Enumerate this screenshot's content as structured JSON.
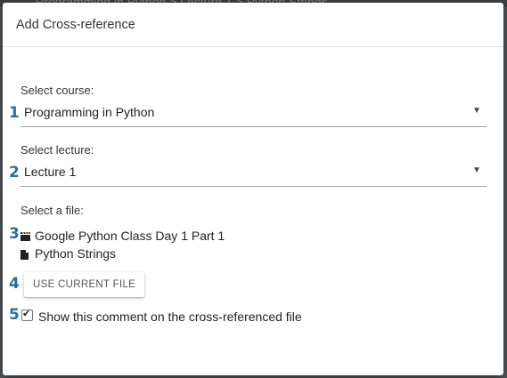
{
  "background": {
    "text": "Programming in Python  >  Lecture 1  >  Python Strings"
  },
  "dialog": {
    "title": "Add Cross-reference",
    "course": {
      "label": "Select course:",
      "value": "Programming in Python",
      "step": "1"
    },
    "lecture": {
      "label": "Select lecture:",
      "value": "Lecture 1",
      "step": "2"
    },
    "file": {
      "label": "Select a file:",
      "step": "3",
      "items": [
        {
          "icon": "video-icon",
          "name": "Google Python Class Day 1 Part 1"
        },
        {
          "icon": "document-icon",
          "name": "Python Strings"
        }
      ]
    },
    "use_current": {
      "label": "USE CURRENT FILE",
      "step": "4"
    },
    "show_comment": {
      "label": "Show this comment on the cross-referenced file",
      "checked": true,
      "step": "5"
    }
  },
  "colors": {
    "step_number": "#2f6e97",
    "divider": "#9e9e9e",
    "background": "#505356"
  }
}
